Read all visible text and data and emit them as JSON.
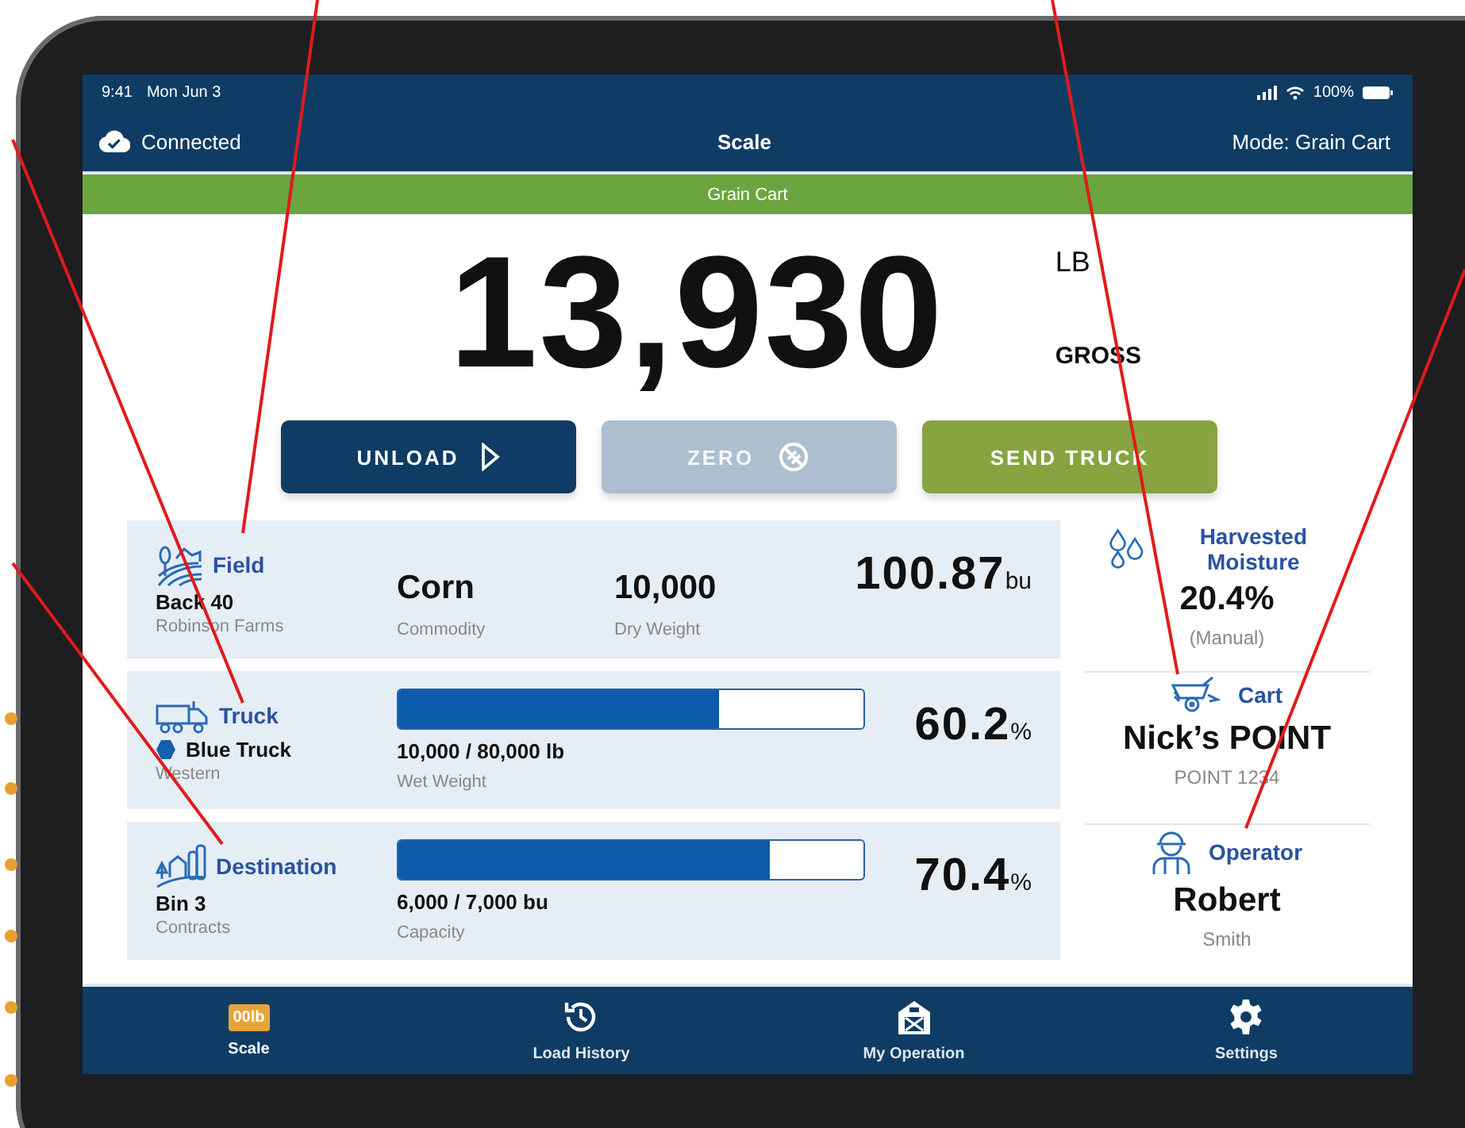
{
  "status_bar": {
    "time": "9:41",
    "date": "Mon Jun 3",
    "battery": "100%"
  },
  "header": {
    "connection": "Connected",
    "title": "Scale",
    "mode": "Mode: Grain Cart"
  },
  "banner": "Grain Cart",
  "weight": {
    "value": "13,930",
    "unit": "LB",
    "type": "GROSS"
  },
  "actions": [
    {
      "label": "UNLOAD",
      "kind": "primary",
      "disabled": false
    },
    {
      "label": "ZERO",
      "kind": "secondary",
      "disabled": true
    },
    {
      "label": "SEND TRUCK",
      "kind": "success",
      "disabled": false
    }
  ],
  "cards": [
    {
      "kind": "stats",
      "title": "Field",
      "name": "Back 40",
      "sub": "Robinson Farms",
      "stats": [
        {
          "value": "Corn",
          "label": "Commodity"
        },
        {
          "value": "10,000",
          "label": "Dry Weight"
        }
      ],
      "total": "100.87",
      "total_unit": "bu"
    },
    {
      "kind": "meter",
      "title": "Truck",
      "name": "Blue Truck",
      "color": "#1560ac",
      "sub": "Western",
      "level": 0.69,
      "reading": "10,000 / 80,000 lb",
      "reading_label": "Wet Weight",
      "total": "60.2",
      "total_unit": "%"
    },
    {
      "kind": "meter",
      "title": "Destination",
      "name": "Bin 3",
      "sub": "Contracts",
      "level": 0.8,
      "reading": "6,000 / 7,000 bu",
      "reading_label": "Capacity",
      "total": "70.4",
      "total_unit": "%"
    }
  ],
  "side": [
    {
      "kind": "moisture",
      "title": "Harvested Moisture",
      "value": "20.4%",
      "sub": "(Manual)"
    },
    {
      "kind": "cart",
      "title": "Cart",
      "value": "Nick’s POINT",
      "sub": "POINT 1234"
    },
    {
      "kind": "operator",
      "title": "Operator",
      "value": "Robert",
      "sub": "Smith"
    }
  ],
  "nav": [
    {
      "label": "Scale",
      "icon_text": "00lb",
      "kind": "scale",
      "selected": true
    },
    {
      "label": "Load History",
      "kind": "history",
      "selected": false
    },
    {
      "label": "My Operation",
      "kind": "barn",
      "selected": false
    },
    {
      "label": "Settings",
      "kind": "settings",
      "selected": false
    }
  ]
}
